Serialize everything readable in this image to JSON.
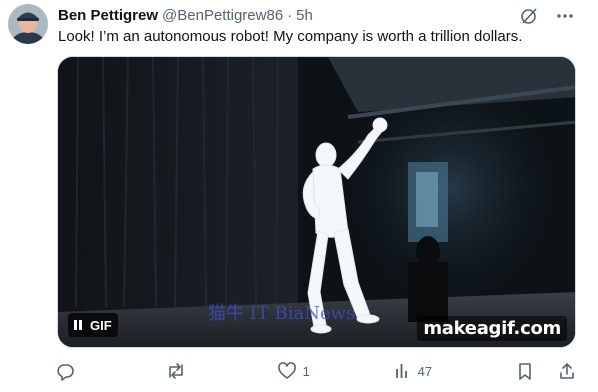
{
  "tweet": {
    "author_name": "Ben Pettigrew",
    "handle": "@BenPettigrew86",
    "separator": "·",
    "time": "5h",
    "text": "Look! I’m an autonomous robot! My company is worth a trillion dollars."
  },
  "media": {
    "badge_label": "GIF",
    "watermark_text": "猫牛 IT BiaNews",
    "brand_text": "makeagif.com"
  },
  "actions": {
    "reply_count": "",
    "retweet_count": "",
    "like_count": "1",
    "views_count": "47"
  },
  "icons": {
    "grok": "grok-icon",
    "more": "more-icon",
    "pause": "pause-icon",
    "reply": "reply-icon",
    "retweet": "retweet-icon",
    "like": "heart-icon",
    "views": "views-icon",
    "share": "share-icon"
  },
  "colors": {
    "text_primary": "#0f1419",
    "text_secondary": "#536471",
    "border": "#cfd9de"
  }
}
